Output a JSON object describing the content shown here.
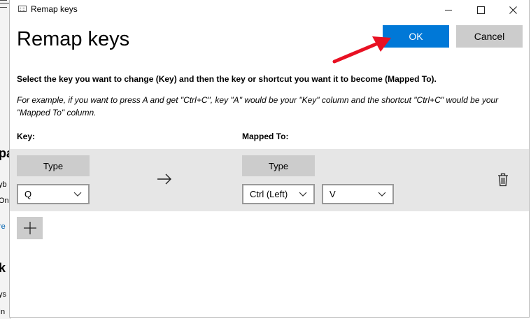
{
  "window": {
    "title": "Remap keys"
  },
  "page": {
    "title": "Remap keys",
    "ok_label": "OK",
    "cancel_label": "Cancel",
    "instruction": "Select the key you want to change (Key) and then the key or shortcut you want it to become (Mapped To).",
    "example": "For example, if you want to press A and get \"Ctrl+C\", key \"A\" would be your \"Key\" column and the shortcut \"Ctrl+C\" would be your \"Mapped To\" column.",
    "key_header": "Key:",
    "mapped_header": "Mapped To:"
  },
  "row": {
    "key_type_label": "Type",
    "key_value": "Q",
    "mapped_type_label": "Type",
    "mapped_modifier": "Ctrl (Left)",
    "mapped_key": "V"
  },
  "background_app": {
    "fragments": [
      "pa",
      "yb",
      "On",
      "re",
      "k",
      "ys",
      "In"
    ]
  },
  "icons": {
    "app": "keyboard-icon",
    "arrow": "arrow-right-icon",
    "delete": "trash-icon",
    "add": "plus-icon",
    "annotation": "red-arrow-annotation"
  },
  "colors": {
    "accent": "#0078d7",
    "button_gray": "#cccccc",
    "row_bg": "#e6e6e6",
    "annotation_red": "#e81123",
    "link_blue": "#0063b1"
  }
}
